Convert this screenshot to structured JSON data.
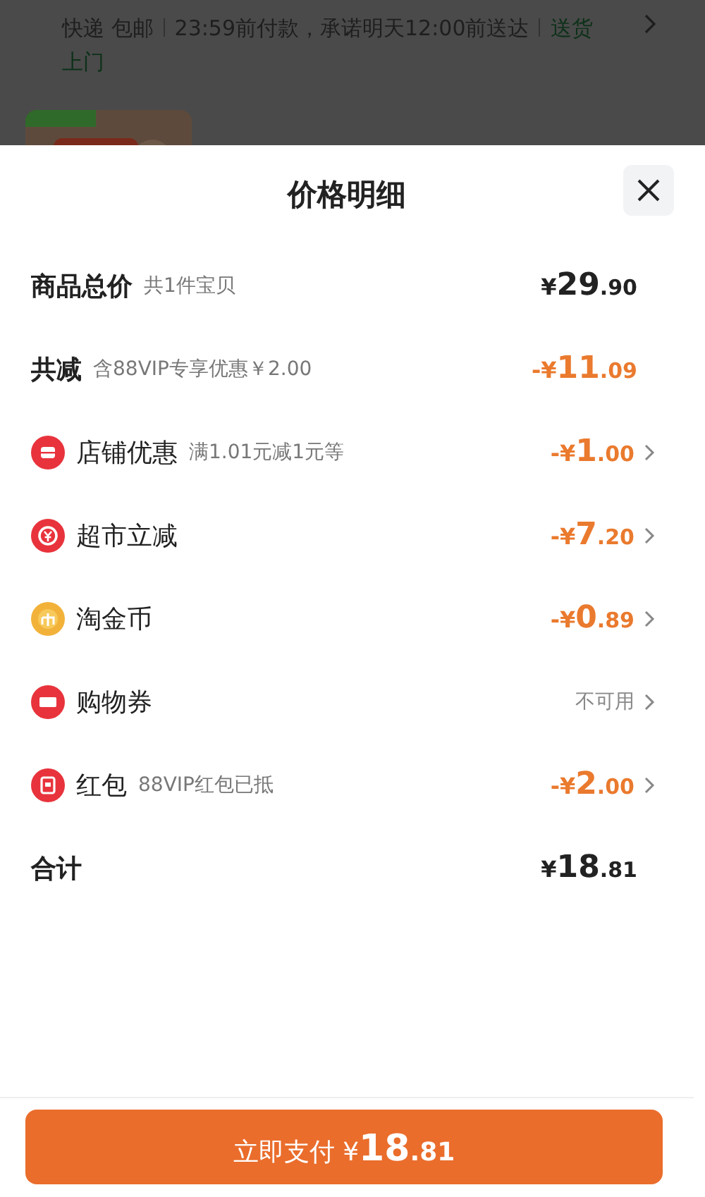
{
  "background_page": {
    "delivery": {
      "method": "快递 包邮",
      "promise": "23:59前付款，承诺明天12:00前送达",
      "service": "送货上门"
    }
  },
  "sheet": {
    "title": "价格明细",
    "rows": [
      {
        "kind": "summary",
        "label": "商品总价",
        "note": "共1件宝贝",
        "value": {
          "kind": "price",
          "prefix": "¥",
          "int": "29",
          "dec": ".90"
        },
        "chevron": false
      },
      {
        "kind": "summary",
        "label": "共减",
        "note": "含88VIP专享优惠￥2.00",
        "value": {
          "kind": "discount",
          "prefix": "-¥",
          "int": "11",
          "dec": ".09"
        },
        "chevron": false
      },
      {
        "kind": "discount",
        "label": "店铺优惠",
        "note": "满1.01元减1元等",
        "color": "#e8333c",
        "value": {
          "kind": "discount",
          "prefix": "-¥",
          "int": "1",
          "dec": ".00"
        },
        "chevron": true
      },
      {
        "kind": "discount",
        "label": "超市立减",
        "color": "#e8333c",
        "value": {
          "kind": "discount",
          "prefix": "-¥",
          "int": "7",
          "dec": ".20"
        },
        "chevron": true
      },
      {
        "kind": "discount",
        "label": "淘金币",
        "color": "#f2b23a",
        "value": {
          "kind": "discount",
          "prefix": "-¥",
          "int": "0",
          "dec": ".89"
        },
        "chevron": true
      },
      {
        "kind": "discount",
        "label": "购物券",
        "color": "#e8333c",
        "value": {
          "kind": "unavailable",
          "text": "不可用"
        },
        "chevron": true
      },
      {
        "kind": "discount",
        "label": "红包",
        "note": "88VIP红包已抵",
        "color": "#e8333c",
        "value": {
          "kind": "discount",
          "prefix": "-¥",
          "int": "2",
          "dec": ".00"
        },
        "chevron": true
      },
      {
        "kind": "total",
        "label": "合计",
        "value": {
          "kind": "price",
          "prefix": "¥",
          "int": "18",
          "dec": ".81"
        },
        "chevron": false
      }
    ],
    "pay_button": {
      "label": "立即支付",
      "prefix": "¥",
      "int": "18",
      "dec": ".81"
    }
  }
}
